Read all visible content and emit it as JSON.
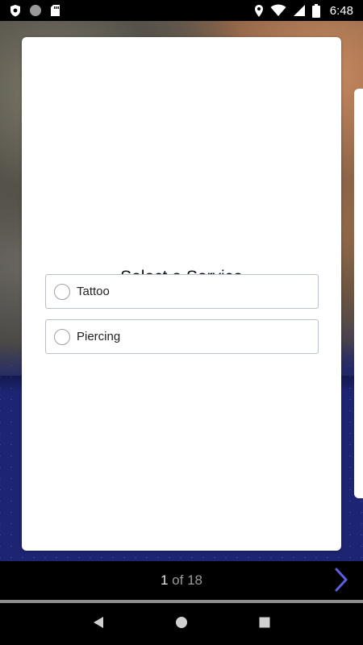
{
  "status_bar": {
    "time": "6:48",
    "icons": [
      "shield-icon",
      "circle-icon",
      "sd-card-icon",
      "location-icon",
      "wifi-icon",
      "signal-icon",
      "battery-icon"
    ]
  },
  "card": {
    "title": "Select a Service",
    "options": [
      {
        "label": "Tattoo",
        "selected": false
      },
      {
        "label": "Piercing",
        "selected": false
      }
    ]
  },
  "pager": {
    "current": "1",
    "separator": " of ",
    "total": "18",
    "next_icon": "chevron-right-icon"
  },
  "colors": {
    "accent": "#5b5fe0",
    "pattern_bg": "#1d2573",
    "option_border": "#b9bfcf"
  },
  "navbar": {
    "icons": [
      "back-icon",
      "home-icon",
      "recents-icon"
    ]
  }
}
